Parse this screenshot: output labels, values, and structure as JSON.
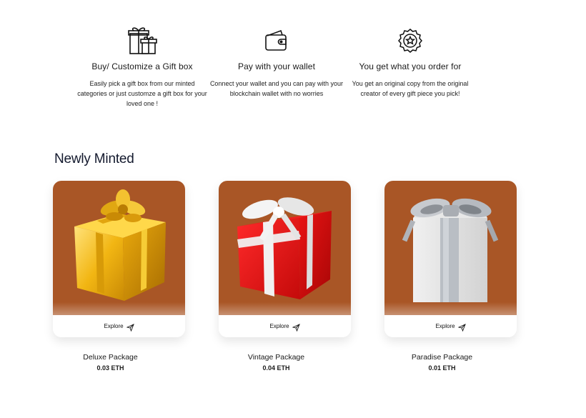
{
  "features": [
    {
      "icon": "gift-boxes-icon",
      "title": "Buy/ Customize a Gift box",
      "description": "Easily pick a gift box from our minted categories or just customze a gift box for your loved one !"
    },
    {
      "icon": "wallet-icon",
      "title": "Pay with your wallet",
      "description": "Connect your wallet and you can pay with your blockchain wallet with no worries"
    },
    {
      "icon": "badge-star-icon",
      "title": "You get what you order for",
      "description": "You get an original copy from the original creator of every gift piece you pick!"
    }
  ],
  "section_title": "Newly Minted",
  "products": [
    {
      "name": "Deluxe Package",
      "price": "0.03 ETH",
      "explore_label": "Explore",
      "image": "gold-gift-box"
    },
    {
      "name": "Vintage Package",
      "price": "0.04 ETH",
      "explore_label": "Explore",
      "image": "red-gift-box"
    },
    {
      "name": "Paradise Package",
      "price": "0.01 ETH",
      "explore_label": "Explore",
      "image": "silver-gift-box"
    }
  ],
  "colors": {
    "card_background": "#a95626",
    "title": "#141a2e"
  }
}
